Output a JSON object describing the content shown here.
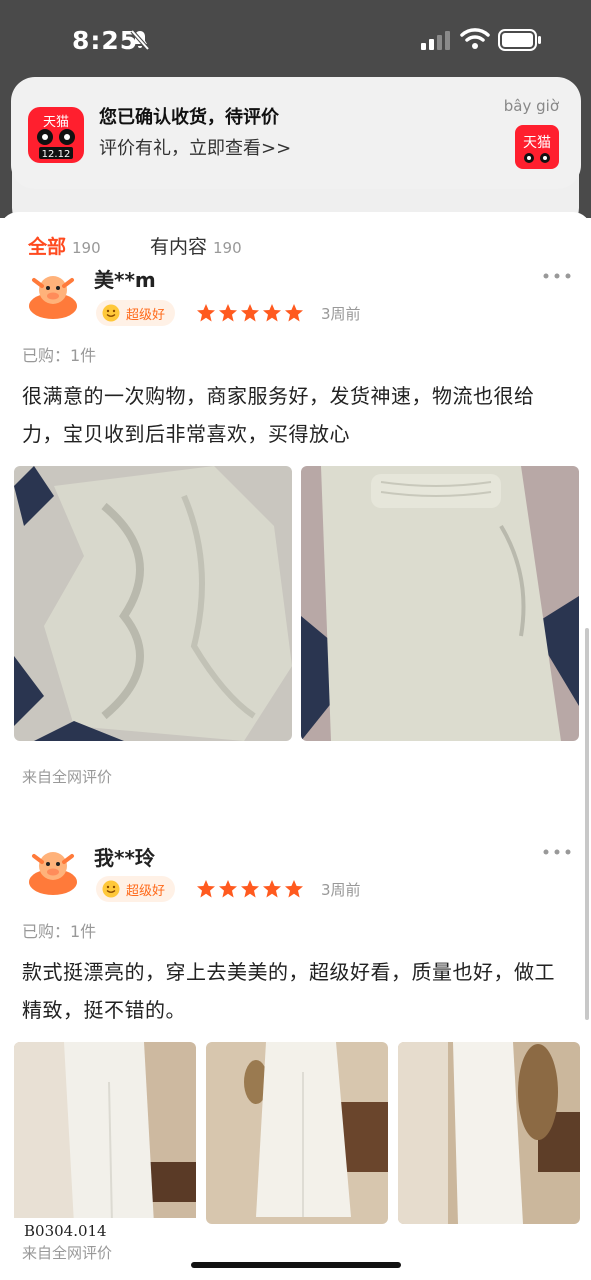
{
  "status_bar": {
    "time": "8:25"
  },
  "notification": {
    "title": "您已确认收货，待评价",
    "body": "评价有礼，立即查看>>",
    "time": "bây giờ",
    "app_badge": "12.12",
    "app_brand": "天猫"
  },
  "tabs": [
    {
      "label": "全部",
      "count": "190",
      "active": true
    },
    {
      "label": "有内容",
      "count": "190",
      "active": false
    }
  ],
  "reviews": [
    {
      "username": "美**m",
      "badge": "超级好",
      "rating": 5,
      "time_ago": "3周前",
      "bought": "已购：1件",
      "text": "很满意的一次购物，商家服务好，发货神速，物流也很给力，宝贝收到后非常喜欢，买得放心",
      "source": "来自全网评价"
    },
    {
      "username": "我**玲",
      "badge": "超级好",
      "rating": 5,
      "time_ago": "3周前",
      "bought": "已购：1件",
      "text": "款式挺漂亮的，穿上去美美的，超级好看，质量也好，做工精致，挺不错的。",
      "source": "来自全网评价"
    }
  ],
  "watermark": "B0304.014",
  "colors": {
    "accent": "#ff4a1f",
    "star": "#ff5a1f",
    "badge_text": "#ff6a1a"
  }
}
